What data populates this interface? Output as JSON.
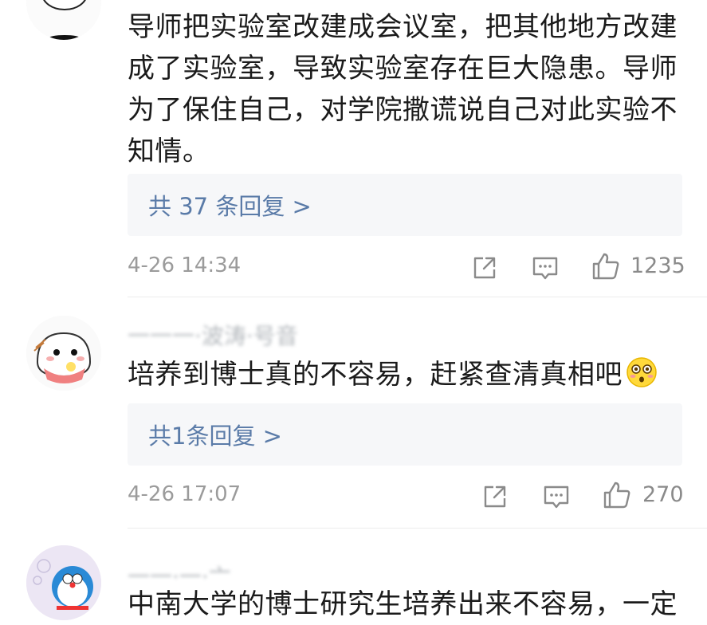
{
  "comments": [
    {
      "username": "",
      "text": "导师把实验室改建成会议室，把其他地方改建成了实验室，导致实验室存在巨大隐患。导师为了保住自己，对学院撒谎说自己对此实验不知情。",
      "replies": "共 37 条回复 >",
      "time": "4-26 14:34",
      "likes": "1235"
    },
    {
      "username": "一一一·波涛·号音",
      "text": "培养到博士真的不容易，赶紧查清真相吧",
      "emoji": "flushed-face-icon",
      "replies": "共1条回复 >",
      "time": "4-26 17:07",
      "likes": "270"
    },
    {
      "username": "一一·一·亠",
      "text": "中南大学的博士研究生培养出来不容易，一定"
    }
  ],
  "colors": {
    "reply_link": "#5a7ba8",
    "meta": "#9b9b9b",
    "reply_bg": "#f6f7f9"
  }
}
